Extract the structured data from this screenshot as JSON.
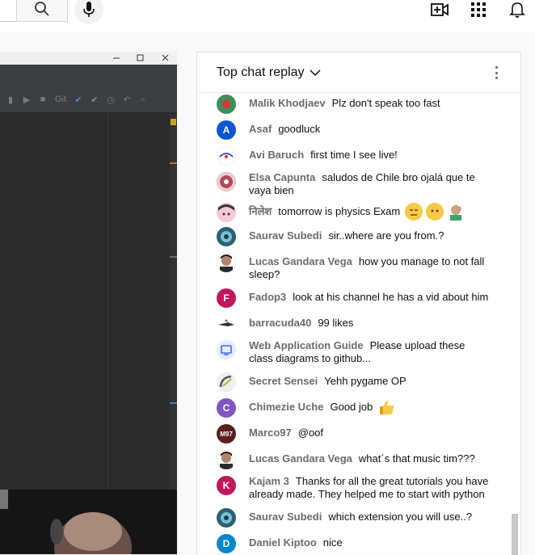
{
  "chat": {
    "title": "Top chat replay",
    "messages": [
      {
        "author": "Malik Khodjaev",
        "text": "Plz don't speak too fast",
        "avatar_color": "#2e8b57",
        "initial": ""
      },
      {
        "author": "Asaf",
        "text": "goodluck",
        "avatar_color": "#0b57d0",
        "initial": "A"
      },
      {
        "author": "Avi Baruch",
        "text": "first time I see live!",
        "avatar_color": "#ffffff",
        "initial": ""
      },
      {
        "author": "Elsa Capunta",
        "text": "saludos de Chile bro ojalá que te vaya bien",
        "avatar_color": "#b5485a",
        "initial": ""
      },
      {
        "author": "निलेश",
        "text": "tomorrow is physics Exam",
        "avatar_color": "#f2b6c6",
        "initial": ""
      },
      {
        "author": "Saurav Subedi",
        "text": "sir..where are you from.?",
        "avatar_color": "#4a90a4",
        "initial": ""
      },
      {
        "author": "Lucas Gandara Vega",
        "text": "how you manage to not fall sleep?",
        "avatar_color": "#3a2a22",
        "initial": ""
      },
      {
        "author": "Fadop3",
        "text": "look at his channel he has a vid about him",
        "avatar_color": "#c2185b",
        "initial": "F"
      },
      {
        "author": "barracuda40",
        "text": "99 likes",
        "avatar_color": "#ffffff",
        "initial": ""
      },
      {
        "author": "Web Application Guide",
        "text": "Please upload these class diagrams to github...",
        "avatar_color": "#e8f0fe",
        "initial": ""
      },
      {
        "author": "Secret Sensei",
        "text": "Yehh pygame OP",
        "avatar_color": "#dcdcdc",
        "initial": ""
      },
      {
        "author": "Chimezie Uche",
        "text": "Good job",
        "avatar_color": "#7e57c2",
        "initial": "C"
      },
      {
        "author": "Marco97",
        "text": "@oof",
        "avatar_color": "#5a1e1e",
        "initial": "M97"
      },
      {
        "author": "Lucas Gandara Vega",
        "text": "what´s that music tim???",
        "avatar_color": "#3a2a22",
        "initial": ""
      },
      {
        "author": "Kajam 3",
        "text": "Thanks for all the great tutorials you have already made. They helped me to start with python",
        "avatar_color": "#c2185b",
        "initial": "K"
      },
      {
        "author": "Saurav Subedi",
        "text": "which extension you will use..?",
        "avatar_color": "#4a90a4",
        "initial": ""
      },
      {
        "author": "Daniel Kiptoo",
        "text": "nice",
        "avatar_color": "#0288d1",
        "initial": "D"
      }
    ]
  },
  "icons": {
    "search": "search-icon",
    "mic": "mic-icon",
    "create": "create-video-icon",
    "apps": "apps-grid-icon",
    "notifications": "bell-icon",
    "dropdown": "chevron-down-icon",
    "more": "more-vert-icon"
  }
}
